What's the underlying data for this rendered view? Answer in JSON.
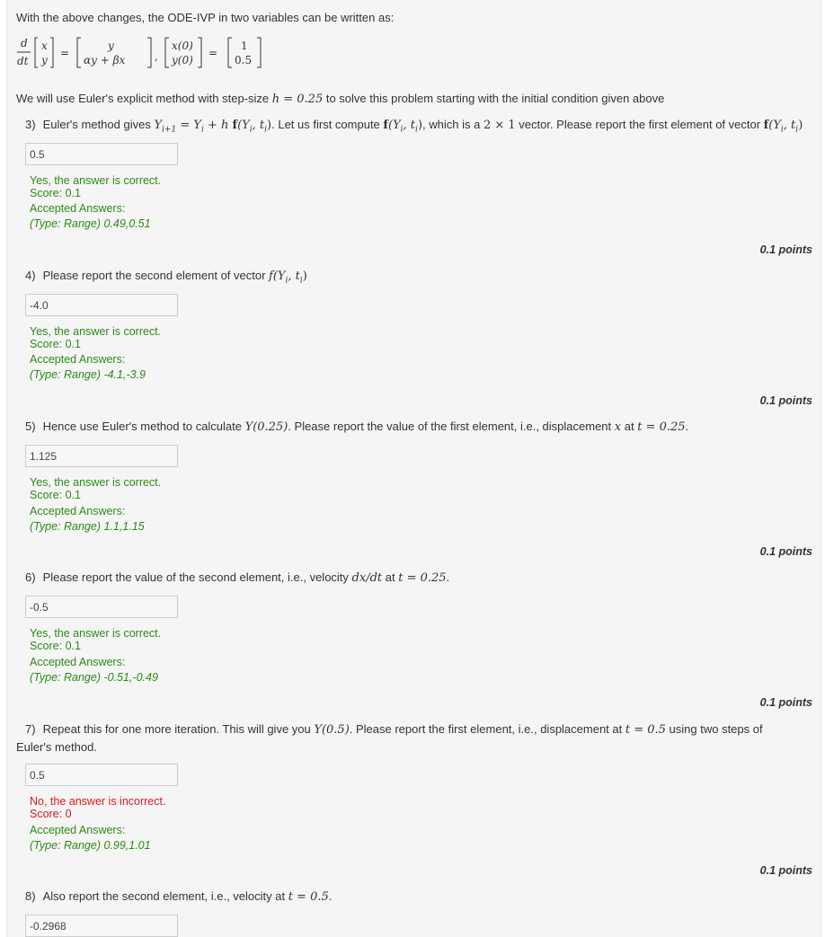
{
  "intro": "With the above changes, the ODE-IVP in two variables can be written as:",
  "equation": {
    "d": "d",
    "dt": "dt",
    "vec_x": "x",
    "vec_y": "y",
    "rhs_top": "y",
    "rhs_bottom": "αy + βx",
    "ic_top": "x(0)",
    "ic_bottom": "y(0)",
    "val_top": "1",
    "val_bottom": "0.5"
  },
  "euler_intro": {
    "before": "We will use Euler's explicit method with step-size ",
    "math": "h = 0.25",
    "after": " to solve this problem starting with the initial condition given above"
  },
  "questions": [
    {
      "number": "3)",
      "text_parts": [
        "Euler's method gives ",
        "Y",
        "i+1",
        " = ",
        "Y",
        "i",
        " + h ",
        "f",
        "(Y",
        "i",
        ", t",
        "i",
        ")",
        ". Let us first compute ",
        "f",
        "(Y",
        "i",
        ", t",
        "i",
        ")",
        ", which is a ",
        "2 × 1",
        " vector. Please report the first element of vector ",
        "f",
        "(Y",
        "i",
        ", t",
        "i",
        ")"
      ],
      "answer": "0.5",
      "status": "Yes, the answer is correct.",
      "score": "Score: 0.1",
      "accepted_label": "Accepted Answers:",
      "accepted_range": "(Type: Range) 0.49,0.51",
      "points": "0.1 points"
    },
    {
      "number": "4)",
      "text": "Please report the second element of vector ",
      "math": "f(Y",
      "answer": "-4.0",
      "status": "Yes, the answer is correct.",
      "score": "Score: 0.1",
      "accepted_label": "Accepted Answers:",
      "accepted_range": "(Type: Range) -4.1,-3.9",
      "points": "0.1 points"
    },
    {
      "number": "5)",
      "text_a": "Hence use Euler's method to calculate ",
      "math_a": "Y(0.25)",
      "text_b": ". Please report the value of the first element, i.e., displacement ",
      "math_b": "x",
      "text_c": " at ",
      "math_c": "t = 0.25",
      "text_d": ".",
      "answer": "1.125",
      "status": "Yes, the answer is correct.",
      "score": "Score: 0.1",
      "accepted_label": "Accepted Answers:",
      "accepted_range": "(Type: Range) 1.1,1.15",
      "points": "0.1 points"
    },
    {
      "number": "6)",
      "text_a": "Please report the value of the second element, i.e., velocity ",
      "math_a": "dx/dt",
      "text_b": " at ",
      "math_b": "t = 0.25",
      "text_c": ".",
      "answer": "-0.5",
      "status": "Yes, the answer is correct.",
      "score": "Score: 0.1",
      "accepted_label": "Accepted Answers:",
      "accepted_range": "(Type: Range) -0.51,-0.49",
      "points": "0.1 points"
    },
    {
      "number": "7)",
      "text_a": "Repeat this for one more iteration. This will give you ",
      "math_a": "Y(0.5)",
      "text_b": ". Please report the first element, i.e., displacement at ",
      "math_b": "t = 0.5",
      "text_c": " using two steps of Euler's method.",
      "answer": "0.5",
      "status": "No, the answer is incorrect.",
      "score": "Score: 0",
      "accepted_label": "Accepted Answers:",
      "accepted_range": "(Type: Range) 0.99,1.01",
      "points": "0.1 points"
    },
    {
      "number": "8)",
      "text_a": "Also report the second element, i.e., velocity at ",
      "math_a": "t = 0.5",
      "text_b": ".",
      "answer": "-0.2968"
    }
  ],
  "colors": {
    "correct": "#2b8a16",
    "incorrect": "#d9181f",
    "panel": "#f5f5f5"
  }
}
